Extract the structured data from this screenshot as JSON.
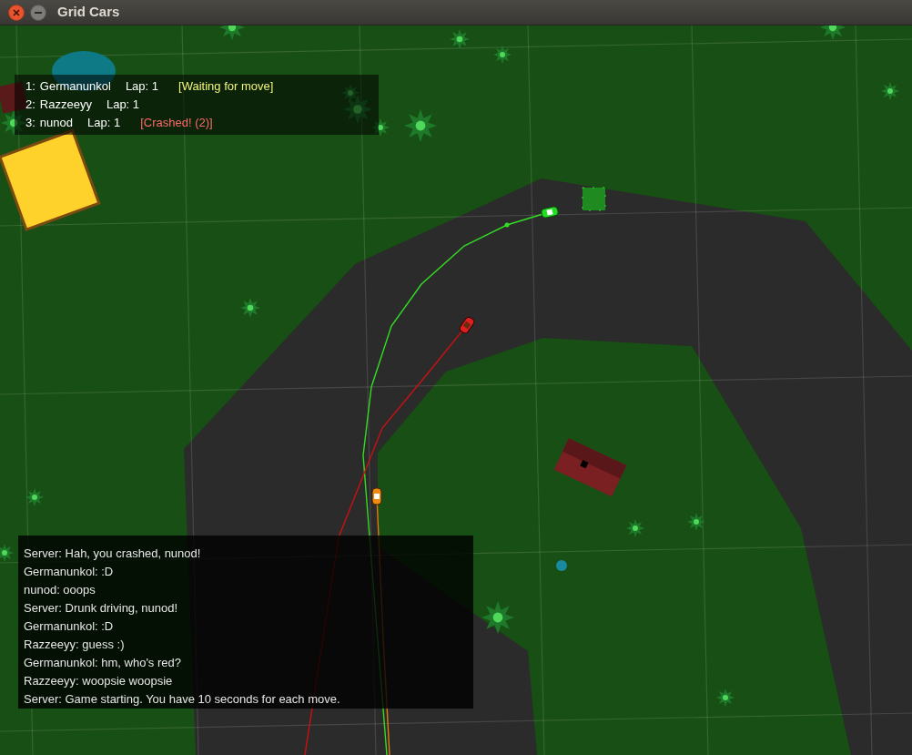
{
  "window": {
    "title": "Grid Cars"
  },
  "scoreboard": [
    {
      "rank": "1:",
      "name": "Germanunkol",
      "lap": "Lap: 1",
      "status": "[Waiting for move]",
      "kind": "waiting"
    },
    {
      "rank": "2:",
      "name": "Razzeeyy",
      "lap": "Lap: 1"
    },
    {
      "rank": "3:",
      "name": "nunod",
      "lap": "Lap: 1",
      "status": "[Crashed! (2)]",
      "kind": "crashed"
    }
  ],
  "chat": [
    "Server: Hah, you crashed, nunod!",
    "Germanunkol: :D",
    "nunod: ooops",
    "Server: Drunk driving, nunod!",
    "Germanunkol: :D",
    "Razzeeyy: guess :)",
    "Germanunkol: hm, who's red?",
    "Razzeeyy: woopsie woopsie",
    "Server: Game starting. You have 10 seconds for each move."
  ]
}
